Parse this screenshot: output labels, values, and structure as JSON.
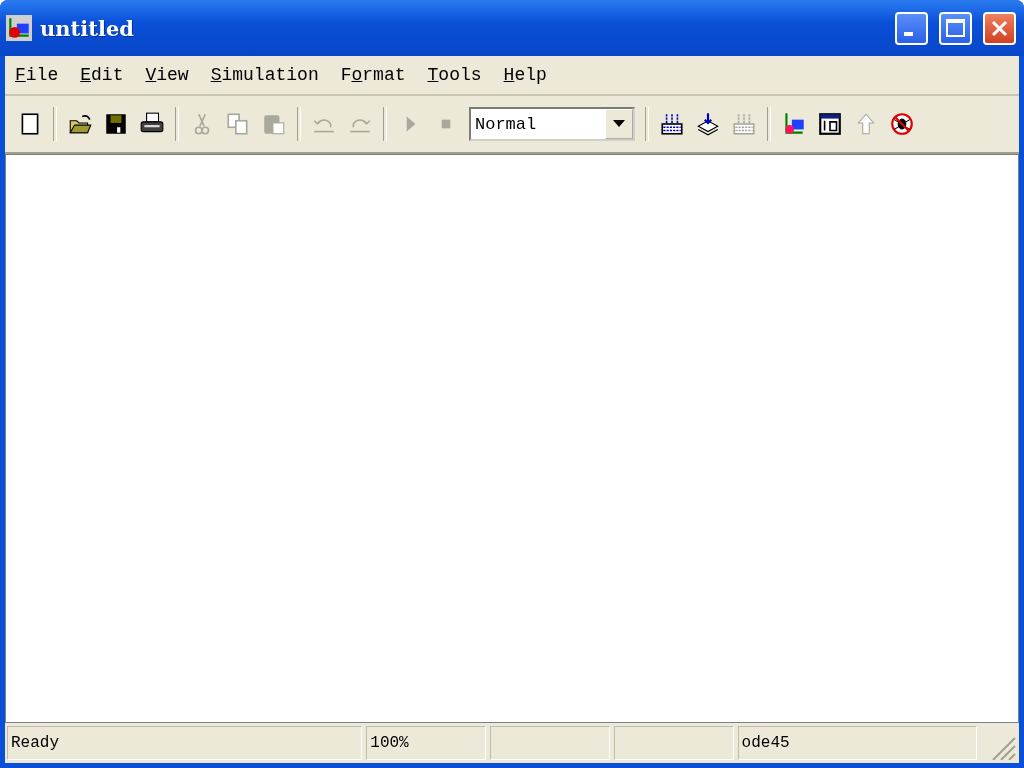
{
  "window": {
    "title": "untitled"
  },
  "menu": [
    {
      "key": "F",
      "after": "ile"
    },
    {
      "key": "E",
      "after": "dit"
    },
    {
      "key": "V",
      "after": "iew"
    },
    {
      "key": "S",
      "after": "imulation"
    },
    {
      "before": "F",
      "key": "o",
      "after": "rmat"
    },
    {
      "key": "T",
      "after": "ools"
    },
    {
      "key": "H",
      "after": "elp"
    }
  ],
  "toolbar": [
    {
      "kind": "new",
      "disabled": false
    },
    {
      "kind": "separator"
    },
    {
      "kind": "open",
      "disabled": false
    },
    {
      "kind": "save",
      "disabled": false
    },
    {
      "kind": "print",
      "disabled": false
    },
    {
      "kind": "separator"
    },
    {
      "kind": "cut",
      "disabled": true
    },
    {
      "kind": "copy",
      "disabled": true
    },
    {
      "kind": "paste",
      "disabled": true
    },
    {
      "kind": "separator"
    },
    {
      "kind": "undo",
      "disabled": true
    },
    {
      "kind": "redo",
      "disabled": true
    },
    {
      "kind": "separator"
    },
    {
      "kind": "play",
      "disabled": true
    },
    {
      "kind": "stop",
      "disabled": true
    },
    {
      "kind": "combo",
      "value": "Normal"
    },
    {
      "kind": "separator"
    },
    {
      "kind": "build",
      "disabled": false
    },
    {
      "kind": "update",
      "disabled": false
    },
    {
      "kind": "incremental",
      "disabled": true
    },
    {
      "kind": "separator"
    },
    {
      "kind": "library",
      "disabled": false
    },
    {
      "kind": "explorer",
      "disabled": false
    },
    {
      "kind": "parent",
      "disabled": true
    },
    {
      "kind": "debug",
      "disabled": false
    }
  ],
  "status_bar": {
    "message": "Ready",
    "zoom": "100%",
    "solver": "ode45"
  }
}
